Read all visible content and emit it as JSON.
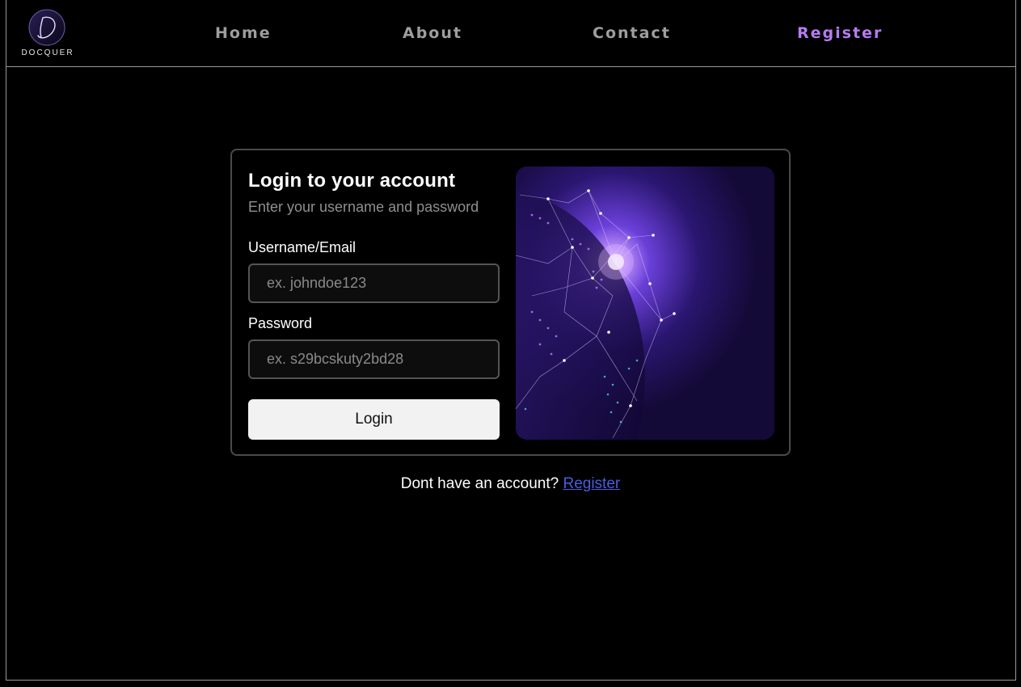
{
  "brand": {
    "name": "DOCQUER",
    "logo_icon": "script-d-logo"
  },
  "nav": {
    "items": [
      {
        "label": "Home"
      },
      {
        "label": "About"
      },
      {
        "label": "Contact"
      },
      {
        "label": "Register",
        "active": true
      }
    ],
    "active_color": "#b57cf0"
  },
  "login": {
    "title": "Login to your account",
    "subtitle": "Enter your username and password",
    "username_label": "Username/Email",
    "username_placeholder": "ex. johndoe123",
    "username_value": "",
    "password_label": "Password",
    "password_placeholder": "ex. s29bcskuty2bd28",
    "password_value": "",
    "submit_label": "Login",
    "image_icon": "globe-network-illustration"
  },
  "footer": {
    "prompt": "Dont have an account?",
    "link_label": "Register",
    "link_color": "#4a5de0"
  }
}
